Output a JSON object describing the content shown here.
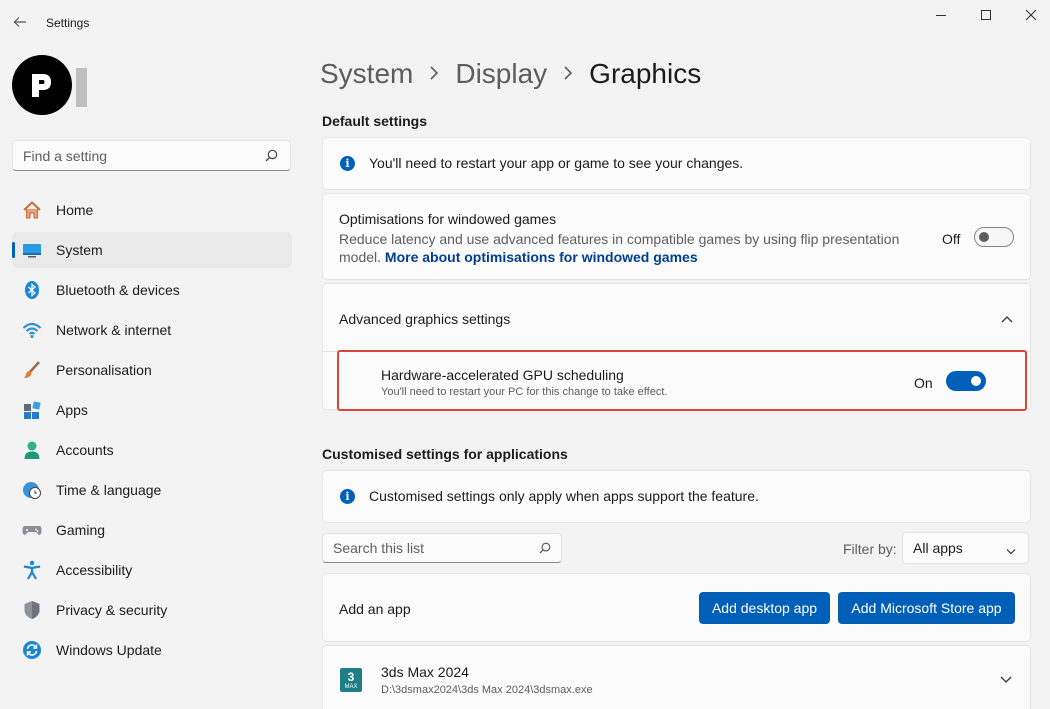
{
  "window": {
    "title": "Settings"
  },
  "sidebar": {
    "search_placeholder": "Find a setting",
    "items": [
      {
        "label": "Home",
        "icon": "home-icon",
        "active": false
      },
      {
        "label": "System",
        "icon": "system-icon",
        "active": true
      },
      {
        "label": "Bluetooth & devices",
        "icon": "bluetooth-icon",
        "active": false
      },
      {
        "label": "Network & internet",
        "icon": "wifi-icon",
        "active": false
      },
      {
        "label": "Personalisation",
        "icon": "brush-icon",
        "active": false
      },
      {
        "label": "Apps",
        "icon": "apps-icon",
        "active": false
      },
      {
        "label": "Accounts",
        "icon": "person-icon",
        "active": false
      },
      {
        "label": "Time & language",
        "icon": "clock-globe-icon",
        "active": false
      },
      {
        "label": "Gaming",
        "icon": "gamepad-icon",
        "active": false
      },
      {
        "label": "Accessibility",
        "icon": "accessibility-icon",
        "active": false
      },
      {
        "label": "Privacy & security",
        "icon": "shield-icon",
        "active": false
      },
      {
        "label": "Windows Update",
        "icon": "update-icon",
        "active": false
      }
    ]
  },
  "breadcrumb": {
    "items": [
      "System",
      "Display"
    ],
    "current": "Graphics"
  },
  "default_settings": {
    "heading": "Default settings",
    "info": "You'll need to restart your app or game to see your changes.",
    "windowed": {
      "title": "Optimisations for windowed games",
      "desc": "Reduce latency and use advanced features in compatible games by using flip presentation model.",
      "link": "More about optimisations for windowed games",
      "state_label": "Off"
    },
    "advanced": {
      "title": "Advanced graphics settings"
    },
    "gpu": {
      "title": "Hardware-accelerated GPU scheduling",
      "desc": "You'll need to restart your PC for this change to take effect.",
      "state_label": "On"
    }
  },
  "custom_settings": {
    "heading": "Customised settings for applications",
    "info": "Customised settings only apply when apps support the feature.",
    "search_placeholder": "Search this list",
    "filter_label": "Filter by:",
    "filter_value": "All apps",
    "add_app": {
      "label": "Add an app",
      "desktop_button": "Add desktop app",
      "store_button": "Add Microsoft Store app"
    },
    "apps": [
      {
        "name": "3ds Max 2024",
        "path": "D:\\3dsmax2024\\3ds Max 2024\\3dsmax.exe",
        "icon_text": "3",
        "icon_sub": "MAX"
      }
    ]
  },
  "colors": {
    "accent": "#005fb8",
    "highlight": "#d9473a"
  }
}
